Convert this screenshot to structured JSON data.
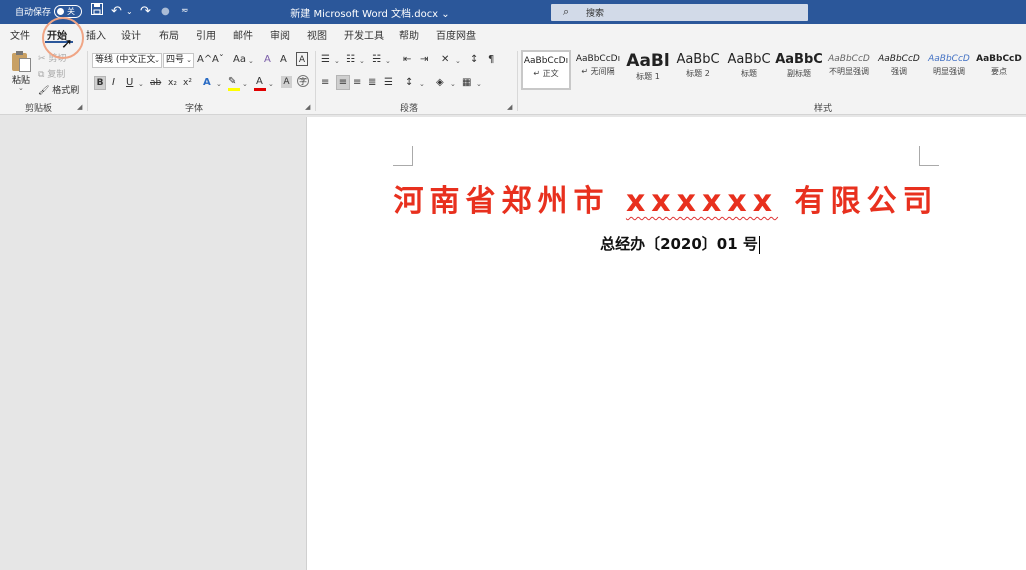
{
  "titlebar": {
    "autosave_label": "自动保存",
    "autosave_state": "关",
    "doc_title": "新建 Microsoft Word 文档.docx",
    "title_dropdown": "⌄",
    "search_placeholder": "搜索",
    "color": "#2b579a"
  },
  "tabs": [
    "文件",
    "开始",
    "插入",
    "设计",
    "布局",
    "引用",
    "邮件",
    "审阅",
    "视图",
    "开发工具",
    "帮助",
    "百度网盘"
  ],
  "active_tab": "开始",
  "clipboard": {
    "paste_label": "粘贴",
    "cut_label": "剪切",
    "copy_label": "复制",
    "format_painter_label": "格式刷",
    "group_label": "剪贴板"
  },
  "font": {
    "font_name": "等线 (中文正文",
    "font_size": "四号",
    "group_label": "字体",
    "bold": "B",
    "italic": "I",
    "underline": "U",
    "strike": "ab",
    "subscript": "x₂",
    "superscript": "x²",
    "grow": "A^",
    "shrink": "Aˇ",
    "change_case": "Aa",
    "clear_format": "A",
    "phonetic": "A",
    "font_color_a": "A",
    "border_char": "A"
  },
  "paragraph": {
    "group_label": "段落"
  },
  "styles": {
    "group_label": "样式",
    "items": [
      {
        "sample": "AaBbCcDı",
        "name": "↵ 正文"
      },
      {
        "sample": "AaBbCcDı",
        "name": "↵ 无间隔"
      },
      {
        "sample": "AaBl",
        "name": "标题 1"
      },
      {
        "sample": "AaBbC",
        "name": "标题 2"
      },
      {
        "sample": "AaBbC",
        "name": "标题"
      },
      {
        "sample": "AaBbC",
        "name": "副标题"
      },
      {
        "sample": "AaBbCcD",
        "name": "不明显强调"
      },
      {
        "sample": "AaBbCcD",
        "name": "强调"
      },
      {
        "sample": "AaBbCcD",
        "name": "明显强调"
      },
      {
        "sample": "AaBbCcD",
        "name": "要点"
      }
    ]
  },
  "document": {
    "heading_part1": "河南省郑州市 ",
    "heading_squiggle": "xxxxxx",
    "heading_part2": " 有限公司",
    "subtitle": "总经办〔2020〕01 号",
    "heading_color": "#e8301e"
  }
}
